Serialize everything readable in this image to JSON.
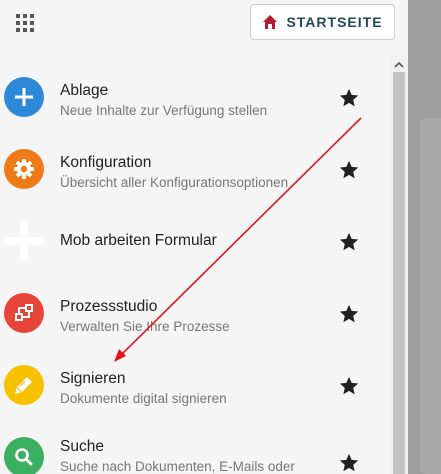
{
  "header": {
    "apps_icon": "grid-icon",
    "home_button_label": "STARTSEITE",
    "home_icon": "home-icon"
  },
  "items": [
    {
      "title": "Ablage",
      "subtitle": "Neue Inhalte zur Verfügung stellen",
      "icon": "plus-icon",
      "color": "#2e8ad8"
    },
    {
      "title": "Konfiguration",
      "subtitle": "Übersicht aller Konfigurationsoptionen",
      "icon": "gear-icon",
      "color": "#ee7b17"
    },
    {
      "title": "Mob arbeiten Formular",
      "subtitle": "",
      "icon": "plus-icon",
      "color": "#ffffff"
    },
    {
      "title": "Prozessstudio",
      "subtitle": "Verwalten Sie Ihre Prozesse",
      "icon": "process-icon",
      "color": "#e8453a"
    },
    {
      "title": "Signieren",
      "subtitle": "Dokumente digital signieren",
      "icon": "pencil-icon",
      "color": "#f7c100"
    },
    {
      "title": "Suche",
      "subtitle": "Suche nach Dokumenten, E-Mails oder",
      "icon": "search-icon",
      "color": "#3cb062"
    }
  ],
  "accent_color": "#b21e2f"
}
